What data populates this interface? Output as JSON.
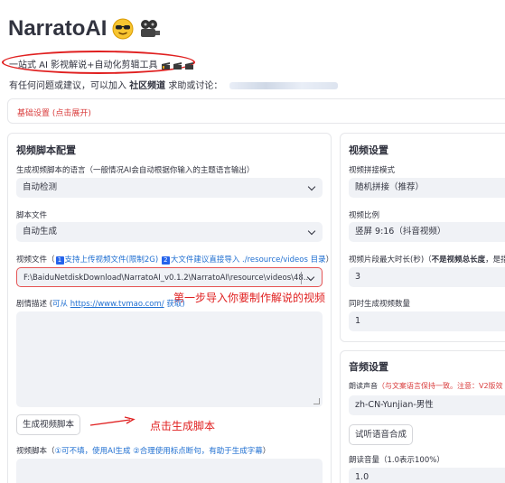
{
  "header": {
    "title": "NarratoAI",
    "subtitle": "一站式 AI 影视解说+自动化剪辑工具",
    "contact_prefix": "有任何问题或建议，可以加入",
    "contact_bold": "社区频道",
    "contact_suffix": "求助或讨论："
  },
  "expander": {
    "label": "基础设置 (点击展开)"
  },
  "left": {
    "title": "视频脚本配置",
    "lang_label": "生成视频脚本的语言（一般情况AI会自动根据你输入的主题语言输出）",
    "lang_value": "自动检测",
    "script_file_label": "脚本文件",
    "script_file_value": "自动生成",
    "video_file_label_prefix": "视频文件（",
    "video_badge1": "1",
    "video_file_label_mid1": "支持上传视频文件(限制2G)",
    "video_badge2": "2",
    "video_file_label_mid2": "大文件建议直接导入 ./resource/videos 目录",
    "video_file_label_suffix": "）",
    "video_file_value": "F:\\BaiduNetdiskDownload\\NarratoAI_v0.1.2\\NarratoAI\\resource\\videos\\48....",
    "plot_label_prefix": "剧情描述 (",
    "plot_label_from": "可从",
    "plot_link": "https://www.tvmao.com/",
    "plot_label_suffix": "获取)",
    "gen_button": "生成视频脚本",
    "script_label_prefix": "视频脚本（",
    "script_label_note": "①可不填，使用AI生成 ②合理使用标点断句，有助于生成字幕",
    "script_label_suffix": "）"
  },
  "right": {
    "title": "视频设置",
    "concat_label": "视频拼接模式",
    "concat_value": "随机拼接（推荐）",
    "ratio_label": "视频比例",
    "ratio_value": "竖屏 9:16（抖音视频）",
    "clip_label_prefix": "视频片段最大时长(秒)（",
    "clip_label_bold": "不是视频总长度",
    "clip_label_suffix": "，是指每",
    "clip_value": "3",
    "count_label": "同时生成视频数量",
    "count_value": "1"
  },
  "audio": {
    "title": "音频设置",
    "voice_label_prefix": "朗读声音",
    "voice_label_red": "（与文案语言保持一致。注意：V2版效",
    "voice_value": "zh-CN-Yunjian-男性",
    "test_button": "试听语音合成",
    "volume_label": "朗读音量（1.0表示100%）",
    "volume_value": "1.0"
  },
  "annotations": {
    "step1": "第一步导入你要制作解说的视频",
    "step2": "点击生成脚本"
  },
  "colors": {
    "annotation": "#e02020",
    "link": "#1f6fd1",
    "input_bg": "#f0f2f6",
    "text": "#31333f"
  },
  "icons": [
    "smiling-face-with-sunglasses-icon",
    "film-projector-icon",
    "clapper-icon",
    "chevron-down-icon"
  ]
}
